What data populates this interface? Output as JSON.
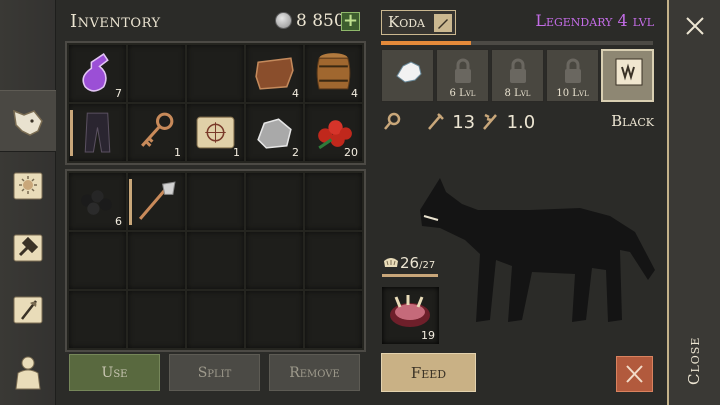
{
  "inventory": {
    "title": "Inventory",
    "currency": "8 850",
    "grid": [
      {
        "icon": "potion-icon",
        "count": "7"
      },
      {
        "icon": "",
        "count": ""
      },
      {
        "icon": "",
        "count": ""
      },
      {
        "icon": "leather-icon",
        "count": "4"
      },
      {
        "icon": "barrel-icon",
        "count": "4"
      },
      {
        "icon": "pants-icon",
        "count": ""
      },
      {
        "icon": "key-icon",
        "count": "1"
      },
      {
        "icon": "map-scroll-icon",
        "count": "1"
      },
      {
        "icon": "ore-icon",
        "count": "2"
      },
      {
        "icon": "berries-icon",
        "count": "20"
      }
    ],
    "grid2": [
      {
        "icon": "coal-icon",
        "count": "6"
      },
      {
        "icon": "shovel-icon",
        "count": ""
      }
    ],
    "buttons": {
      "use": "Use",
      "split": "Split",
      "remove": "Remove"
    }
  },
  "pet": {
    "name": "Koda",
    "rarity": "Legendary 4 lvl",
    "xp_fraction": 0.33,
    "skills": [
      {
        "icon": "wolf-skill-icon",
        "lvl": ""
      },
      {
        "icon": "lock-icon",
        "lvl": "6 Lvl"
      },
      {
        "icon": "lock-icon",
        "lvl": "8 Lvl"
      },
      {
        "icon": "lock-icon",
        "lvl": "10 Lvl"
      },
      {
        "icon": "fang-book-icon",
        "lvl": ""
      }
    ],
    "attack": "13",
    "speed": "1.0",
    "color": "Black",
    "food_current": "26",
    "food_max": "/27",
    "meat_count": "19",
    "feed_label": "Feed"
  },
  "close_label": "Close",
  "colors": {
    "rarity": "#c36ce6",
    "xp": "#e48a3a",
    "use_btn": "#59693f",
    "feed_btn": "#c9b185",
    "cancel": "#b25a3d"
  }
}
